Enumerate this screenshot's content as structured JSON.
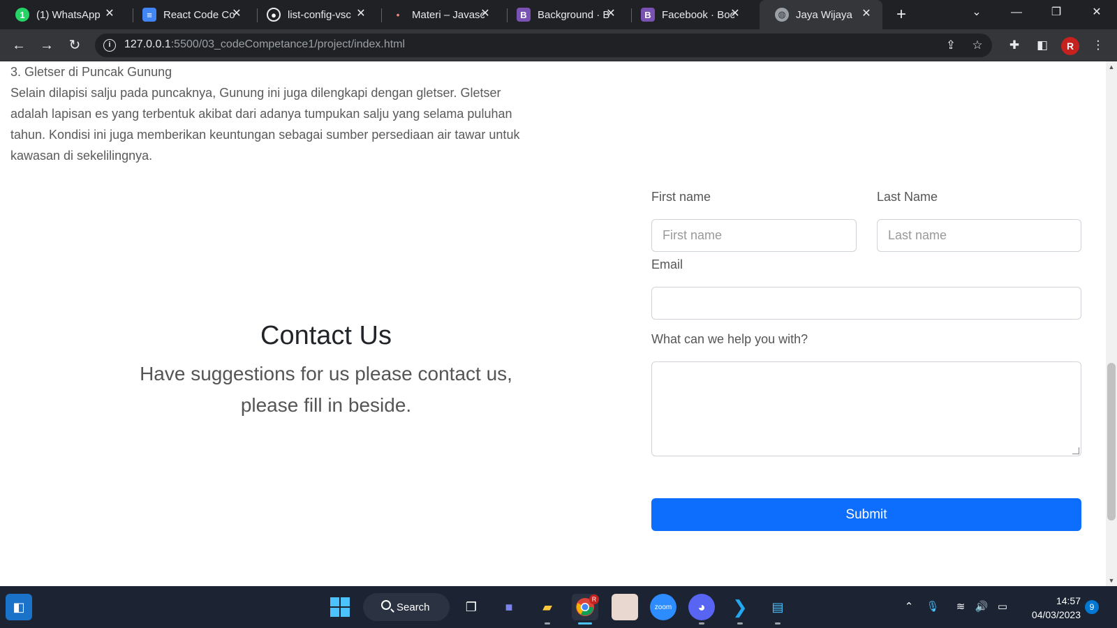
{
  "browser": {
    "tabs": [
      {
        "label": "(1) WhatsApp",
        "icon": "whatsapp-icon",
        "icon_text": "1",
        "icon_color": "#25d366"
      },
      {
        "label": "React Code Co",
        "icon": "document-icon",
        "icon_text": "≡",
        "icon_color": "#4285f4"
      },
      {
        "label": "list-config-vsc",
        "icon": "github-icon",
        "icon_text": "●",
        "icon_color": "#202124"
      },
      {
        "label": "Materi – Javasc",
        "icon": "dots-icon",
        "icon_text": "•",
        "icon_color": "#202124"
      },
      {
        "label": "Background · B",
        "icon": "bootstrap-icon",
        "icon_text": "B",
        "icon_color": "#7952b3"
      },
      {
        "label": "Facebook · Boo",
        "icon": "bootstrap-icon",
        "icon_text": "B",
        "icon_color": "#7952b3"
      },
      {
        "label": "Jaya Wijaya",
        "icon": "globe-icon",
        "icon_text": "◍",
        "icon_color": "#35363a"
      }
    ],
    "active_tab": 6,
    "address": {
      "host": "127.0.0.1",
      "path": ":5500/03_codeCompetance1/project/index.html"
    },
    "profile_initial": "R"
  },
  "article": {
    "heading": "3. Gletser di Puncak Gunung",
    "body": "Selain dilapisi salju pada puncaknya, Gunung ini juga dilengkapi dengan gletser. Gletser adalah lapisan es yang terbentuk akibat dari adanya tumpukan salju yang selama puluhan tahun. Kondisi ini juga memberikan keuntungan sebagai sumber persediaan air tawar untuk kawasan di sekelilingnya."
  },
  "contact": {
    "title": "Contact Us",
    "subtitle": "Have suggestions for us please contact us, please fill in beside."
  },
  "form": {
    "first_name_label": "First name",
    "first_name_placeholder": "First name",
    "last_name_label": "Last Name",
    "last_name_placeholder": "Last name",
    "email_label": "Email",
    "message_label": "What can we help you with?",
    "submit_label": "Submit",
    "submit_color": "#0d6efd"
  },
  "taskbar": {
    "search_label": "Search",
    "chrome_badge": "R",
    "time": "14:57",
    "date": "04/03/2023",
    "notification_count": "9"
  }
}
